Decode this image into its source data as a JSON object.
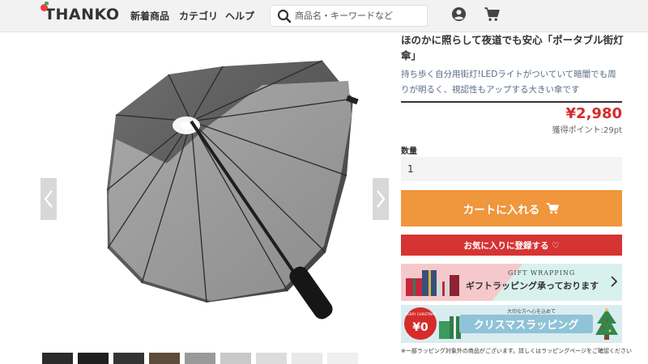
{
  "header": {
    "logo": "THANKO",
    "nav": [
      {
        "label": "新着商品"
      },
      {
        "label": "カテゴリ"
      },
      {
        "label": "ヘルプ"
      }
    ],
    "search": {
      "placeholder": "商品名・キーワードなど",
      "value": ""
    },
    "icons": [
      "search-icon",
      "account-icon",
      "cart-icon"
    ]
  },
  "product": {
    "title": "ほのかに照らして夜道でも安心「ポータブル街灯傘」",
    "description": "持ち歩く自分用街灯!LEDライトがついていて暗闇でも周りが明るく、視認性もアップする大きい傘です",
    "price": "¥2,980",
    "points": "獲得ポイント:29pt",
    "quantity_label": "数量",
    "quantity_value": "1",
    "cart_button": "カートに入れる",
    "favorite_button": "お気に入りに登録する ♡"
  },
  "banners": {
    "gift_en": "GIFT WRAPPING",
    "gift_jp": "ギフトラッピング承っております",
    "xmas_badge_top": "MERRY CHRISTMAS",
    "xmas_badge_price": "¥0",
    "xmas_small": "大切な方へ心を込めて",
    "xmas_big": "クリスマスラッピング"
  },
  "note": "※一部ラッピング対象外の商品がございます。詳しくはラッピングページをご確認ください",
  "colors": {
    "price": "#d62b2b",
    "cart_button": "#f0963d",
    "favorite_button": "#d63333",
    "header_bg": "#f2f2f2"
  }
}
